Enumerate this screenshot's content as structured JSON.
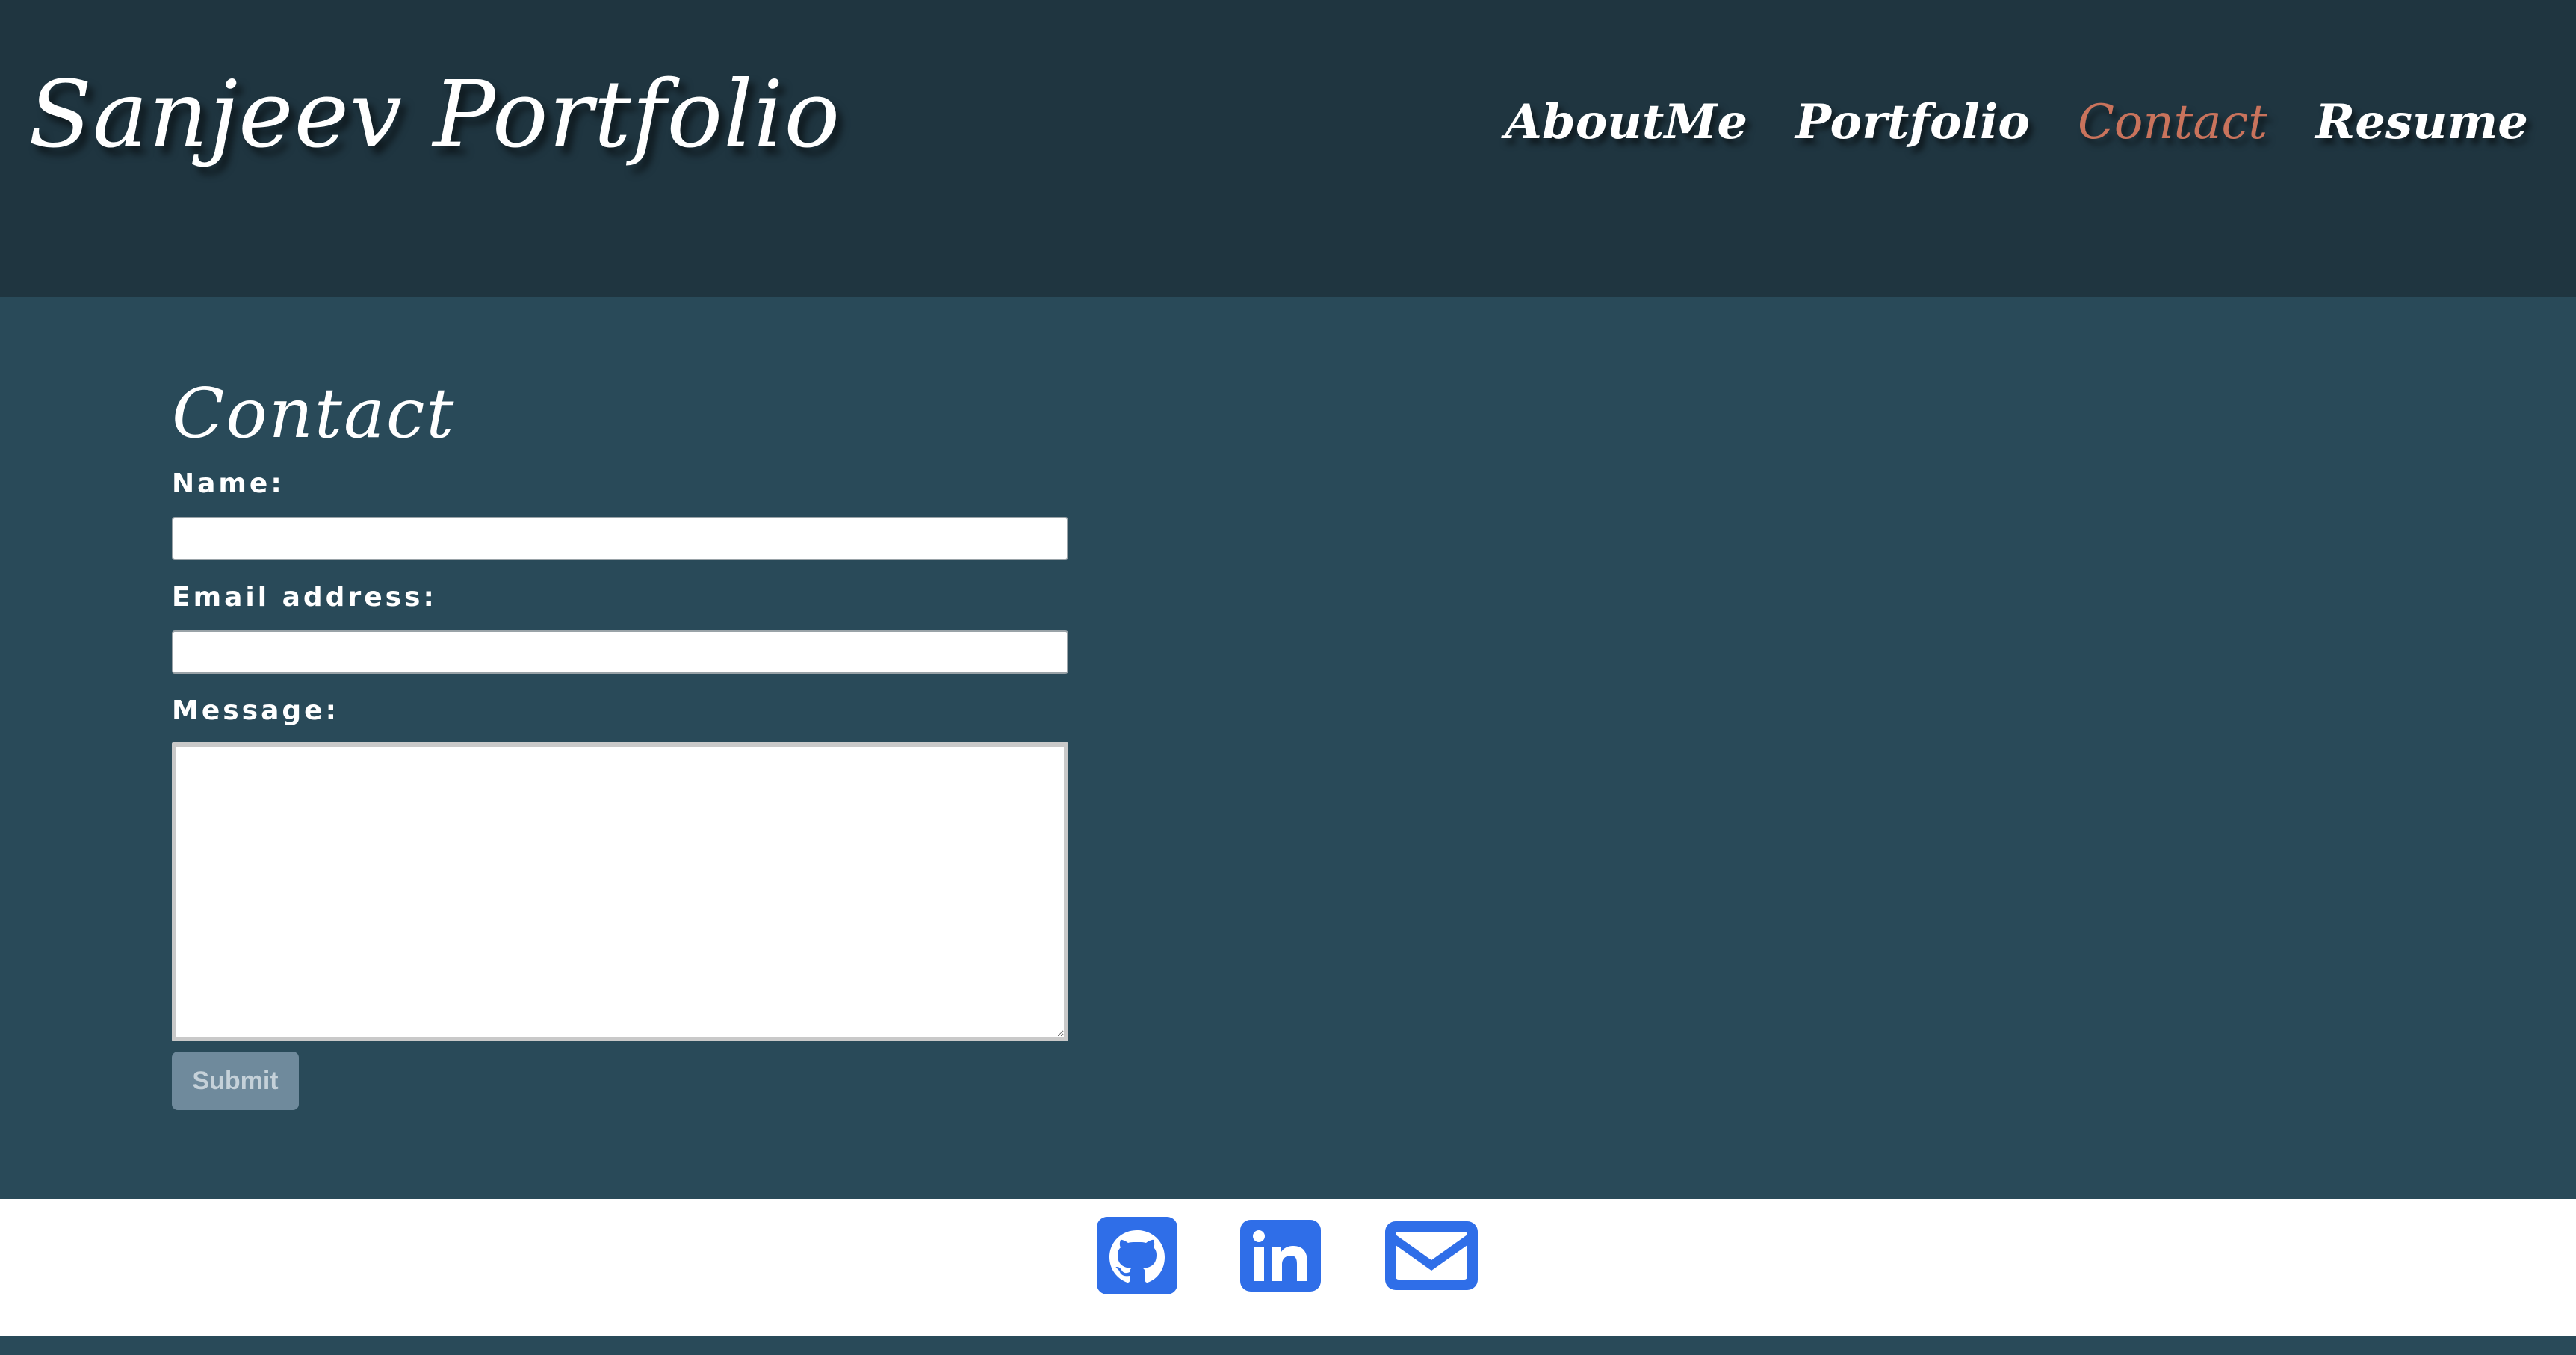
{
  "header": {
    "brand": "Sanjeev Portfolio",
    "nav": [
      {
        "label": "AboutMe",
        "active": false
      },
      {
        "label": "Portfolio",
        "active": false
      },
      {
        "label": "Contact",
        "active": true
      },
      {
        "label": "Resume",
        "active": false
      }
    ]
  },
  "contact": {
    "title": "Contact",
    "name_label": "Name:",
    "name_value": "",
    "email_label": "Email address:",
    "email_value": "",
    "message_label": "Message:",
    "message_value": "",
    "submit_label": "Submit"
  },
  "footer": {
    "icons": [
      {
        "name": "github-icon"
      },
      {
        "name": "linkedin-icon"
      },
      {
        "name": "mail-icon"
      }
    ]
  },
  "colors": {
    "header_bg": "#1f3540",
    "main_bg": "#294a59",
    "active_nav": "#c9735c",
    "icon_blue": "#2f6ee8",
    "submit_bg": "#6f8a9c"
  }
}
